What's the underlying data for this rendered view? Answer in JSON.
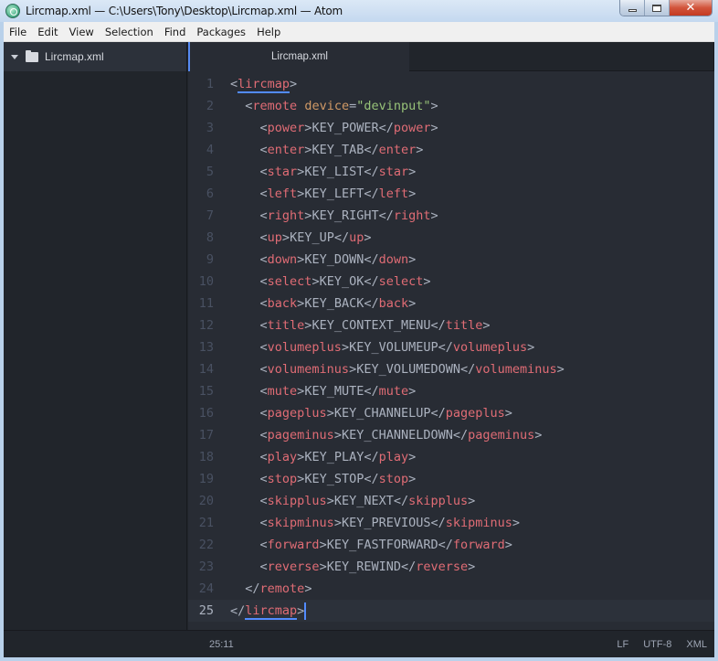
{
  "window": {
    "title": "Lircmap.xml — C:\\Users\\Tony\\Desktop\\Lircmap.xml — Atom",
    "controls": {
      "minimize": "minimize-icon",
      "maximize": "maximize-icon",
      "close": "close-icon",
      "close_glyph": "✕"
    }
  },
  "menu": [
    "File",
    "Edit",
    "View",
    "Selection",
    "Find",
    "Packages",
    "Help"
  ],
  "sidebar": {
    "root_label": "Lircmap.xml",
    "root_icon": "folder-icon",
    "expanded": true
  },
  "tabs": [
    {
      "label": "Lircmap.xml",
      "active": true
    }
  ],
  "editor": {
    "cursor_line": 25,
    "lines": [
      {
        "n": "1",
        "indent": 0,
        "kind": "open",
        "tag": "lircmap",
        "matched": true
      },
      {
        "n": "2",
        "indent": 1,
        "kind": "open-attr",
        "tag": "remote",
        "attr": "device",
        "value": "\"devinput\""
      },
      {
        "n": "3",
        "indent": 2,
        "kind": "element",
        "tag": "power",
        "text": "KEY_POWER"
      },
      {
        "n": "4",
        "indent": 2,
        "kind": "element",
        "tag": "enter",
        "text": "KEY_TAB"
      },
      {
        "n": "5",
        "indent": 2,
        "kind": "element",
        "tag": "star",
        "text": "KEY_LIST"
      },
      {
        "n": "6",
        "indent": 2,
        "kind": "element",
        "tag": "left",
        "text": "KEY_LEFT"
      },
      {
        "n": "7",
        "indent": 2,
        "kind": "element",
        "tag": "right",
        "text": "KEY_RIGHT"
      },
      {
        "n": "8",
        "indent": 2,
        "kind": "element",
        "tag": "up",
        "text": "KEY_UP"
      },
      {
        "n": "9",
        "indent": 2,
        "kind": "element",
        "tag": "down",
        "text": "KEY_DOWN"
      },
      {
        "n": "10",
        "indent": 2,
        "kind": "element",
        "tag": "select",
        "text": "KEY_OK"
      },
      {
        "n": "11",
        "indent": 2,
        "kind": "element",
        "tag": "back",
        "text": "KEY_BACK"
      },
      {
        "n": "12",
        "indent": 2,
        "kind": "element",
        "tag": "title",
        "text": "KEY_CONTEXT_MENU"
      },
      {
        "n": "13",
        "indent": 2,
        "kind": "element",
        "tag": "volumeplus",
        "text": "KEY_VOLUMEUP"
      },
      {
        "n": "14",
        "indent": 2,
        "kind": "element",
        "tag": "volumeminus",
        "text": "KEY_VOLUMEDOWN"
      },
      {
        "n": "15",
        "indent": 2,
        "kind": "element",
        "tag": "mute",
        "text": "KEY_MUTE"
      },
      {
        "n": "16",
        "indent": 2,
        "kind": "element",
        "tag": "pageplus",
        "text": "KEY_CHANNELUP"
      },
      {
        "n": "17",
        "indent": 2,
        "kind": "element",
        "tag": "pageminus",
        "text": "KEY_CHANNELDOWN"
      },
      {
        "n": "18",
        "indent": 2,
        "kind": "element",
        "tag": "play",
        "text": "KEY_PLAY"
      },
      {
        "n": "19",
        "indent": 2,
        "kind": "element",
        "tag": "stop",
        "text": "KEY_STOP"
      },
      {
        "n": "20",
        "indent": 2,
        "kind": "element",
        "tag": "skipplus",
        "text": "KEY_NEXT"
      },
      {
        "n": "21",
        "indent": 2,
        "kind": "element",
        "tag": "skipminus",
        "text": "KEY_PREVIOUS"
      },
      {
        "n": "22",
        "indent": 2,
        "kind": "element",
        "tag": "forward",
        "text": "KEY_FASTFORWARD"
      },
      {
        "n": "23",
        "indent": 2,
        "kind": "element",
        "tag": "reverse",
        "text": "KEY_REWIND"
      },
      {
        "n": "24",
        "indent": 1,
        "kind": "close",
        "tag": "remote"
      },
      {
        "n": "25",
        "indent": 0,
        "kind": "close",
        "tag": "lircmap",
        "matched": true,
        "cursor": true
      }
    ]
  },
  "status": {
    "cursor_position": "25:11",
    "line_ending": "LF",
    "encoding": "UTF-8",
    "grammar": "XML"
  },
  "colors": {
    "editor_bg": "#282c34",
    "tag": "#e06c75",
    "attribute": "#d19a66",
    "string": "#98c379",
    "accent": "#528bff"
  }
}
